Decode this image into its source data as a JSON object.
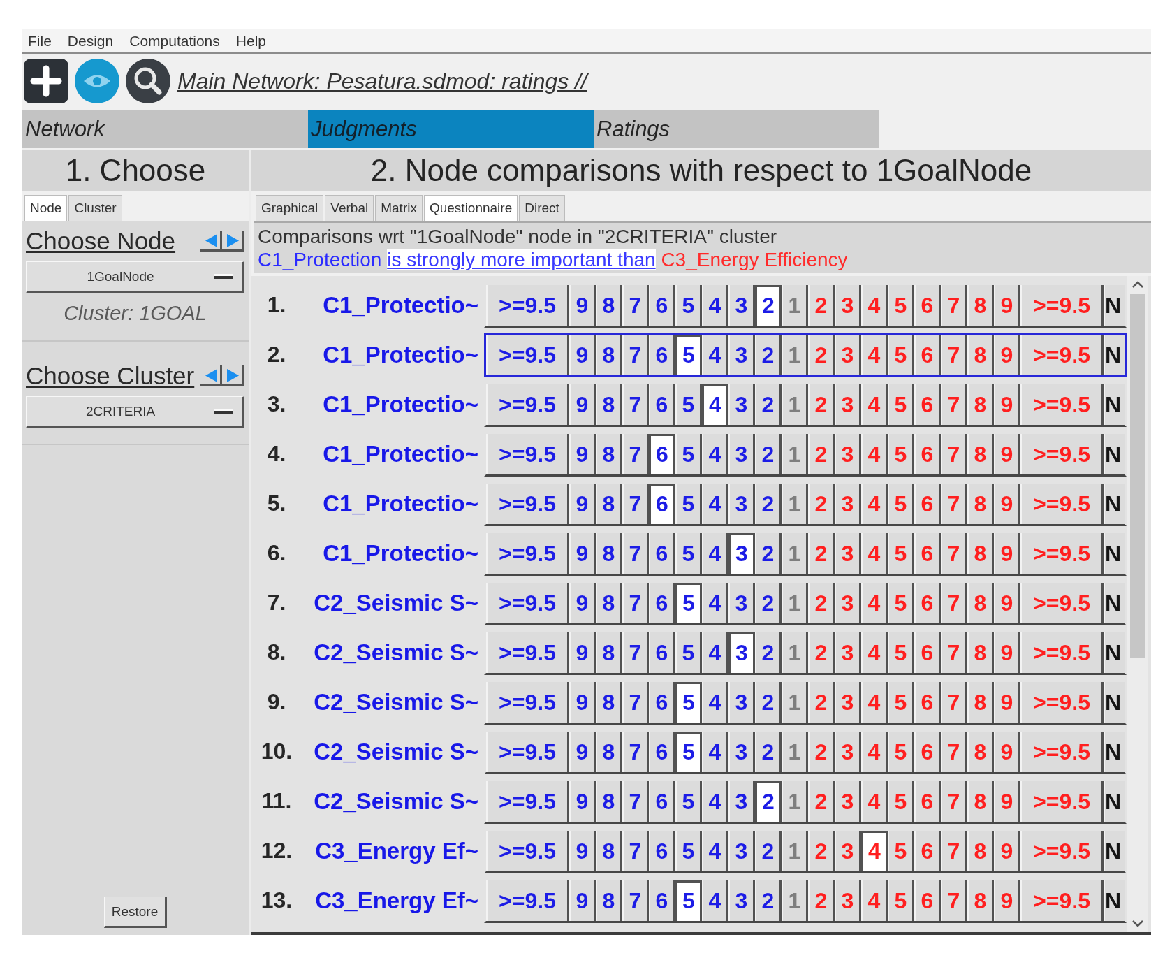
{
  "menu": [
    "File",
    "Design",
    "Computations",
    "Help"
  ],
  "toolbar": {
    "path": "Main Network: Pesatura.sdmod: ratings //"
  },
  "main_tabs": [
    {
      "label": "Network",
      "selected": false
    },
    {
      "label": "Judgments",
      "selected": true
    },
    {
      "label": "Ratings",
      "selected": false
    }
  ],
  "choose_panel": {
    "heading": "1. Choose",
    "tabs": [
      {
        "label": "Node",
        "selected": true
      },
      {
        "label": "Cluster",
        "selected": false
      }
    ],
    "node_label": "Choose Node",
    "node_value": "1GoalNode",
    "cluster_info": "Cluster: 1GOAL",
    "cluster_label": "Choose Cluster",
    "cluster_value": "2CRITERIA",
    "restore": "Restore"
  },
  "comparison_panel": {
    "heading": "2. Node comparisons with respect to 1GoalNode",
    "tabs": [
      {
        "label": "Graphical",
        "selected": false
      },
      {
        "label": "Verbal",
        "selected": false
      },
      {
        "label": "Matrix",
        "selected": false
      },
      {
        "label": "Questionnaire",
        "selected": true
      },
      {
        "label": "Direct",
        "selected": false
      }
    ],
    "description": "Comparisons wrt \"1GoalNode\" node in \"2CRITERIA\" cluster",
    "verdict": {
      "subject": "C1_Protection",
      "relation": "is strongly more important than",
      "object": "C3_Energy Efficiency"
    },
    "rows": [
      {
        "number": "1.",
        "name": "C1_Protectio~",
        "focused": false,
        "left": [
          {
            "label": ">=9.5",
            "selected": false
          },
          {
            "label": "9",
            "selected": false
          },
          {
            "label": "8",
            "selected": false
          },
          {
            "label": "7",
            "selected": false
          },
          {
            "label": "6",
            "selected": false
          },
          {
            "label": "5",
            "selected": false
          },
          {
            "label": "4",
            "selected": false
          },
          {
            "label": "3",
            "selected": false
          },
          {
            "label": "2",
            "selected": true
          }
        ],
        "equal": {
          "label": "1",
          "selected": false
        },
        "right": [
          {
            "label": "2",
            "selected": false
          },
          {
            "label": "3",
            "selected": false
          },
          {
            "label": "4",
            "selected": false
          },
          {
            "label": "5",
            "selected": false
          },
          {
            "label": "6",
            "selected": false
          },
          {
            "label": "7",
            "selected": false
          },
          {
            "label": "8",
            "selected": false
          },
          {
            "label": "9",
            "selected": false
          },
          {
            "label": ">=9.5",
            "selected": false
          }
        ],
        "extra": {
          "label": "N",
          "selected": false
        }
      },
      {
        "number": "2.",
        "name": "C1_Protectio~",
        "focused": true,
        "left": [
          {
            "label": ">=9.5",
            "selected": false
          },
          {
            "label": "9",
            "selected": false
          },
          {
            "label": "8",
            "selected": false
          },
          {
            "label": "7",
            "selected": false
          },
          {
            "label": "6",
            "selected": false
          },
          {
            "label": "5",
            "selected": true
          },
          {
            "label": "4",
            "selected": false
          },
          {
            "label": "3",
            "selected": false
          },
          {
            "label": "2",
            "selected": false
          }
        ],
        "equal": {
          "label": "1",
          "selected": false
        },
        "right": [
          {
            "label": "2",
            "selected": false
          },
          {
            "label": "3",
            "selected": false
          },
          {
            "label": "4",
            "selected": false
          },
          {
            "label": "5",
            "selected": false
          },
          {
            "label": "6",
            "selected": false
          },
          {
            "label": "7",
            "selected": false
          },
          {
            "label": "8",
            "selected": false
          },
          {
            "label": "9",
            "selected": false
          },
          {
            "label": ">=9.5",
            "selected": false
          }
        ],
        "extra": {
          "label": "N",
          "selected": false
        }
      },
      {
        "number": "3.",
        "name": "C1_Protectio~",
        "focused": false,
        "left": [
          {
            "label": ">=9.5",
            "selected": false
          },
          {
            "label": "9",
            "selected": false
          },
          {
            "label": "8",
            "selected": false
          },
          {
            "label": "7",
            "selected": false
          },
          {
            "label": "6",
            "selected": false
          },
          {
            "label": "5",
            "selected": false
          },
          {
            "label": "4",
            "selected": true
          },
          {
            "label": "3",
            "selected": false
          },
          {
            "label": "2",
            "selected": false
          }
        ],
        "equal": {
          "label": "1",
          "selected": false
        },
        "right": [
          {
            "label": "2",
            "selected": false
          },
          {
            "label": "3",
            "selected": false
          },
          {
            "label": "4",
            "selected": false
          },
          {
            "label": "5",
            "selected": false
          },
          {
            "label": "6",
            "selected": false
          },
          {
            "label": "7",
            "selected": false
          },
          {
            "label": "8",
            "selected": false
          },
          {
            "label": "9",
            "selected": false
          },
          {
            "label": ">=9.5",
            "selected": false
          }
        ],
        "extra": {
          "label": "N",
          "selected": false
        }
      },
      {
        "number": "4.",
        "name": "C1_Protectio~",
        "focused": false,
        "left": [
          {
            "label": ">=9.5",
            "selected": false
          },
          {
            "label": "9",
            "selected": false
          },
          {
            "label": "8",
            "selected": false
          },
          {
            "label": "7",
            "selected": false
          },
          {
            "label": "6",
            "selected": true
          },
          {
            "label": "5",
            "selected": false
          },
          {
            "label": "4",
            "selected": false
          },
          {
            "label": "3",
            "selected": false
          },
          {
            "label": "2",
            "selected": false
          }
        ],
        "equal": {
          "label": "1",
          "selected": false
        },
        "right": [
          {
            "label": "2",
            "selected": false
          },
          {
            "label": "3",
            "selected": false
          },
          {
            "label": "4",
            "selected": false
          },
          {
            "label": "5",
            "selected": false
          },
          {
            "label": "6",
            "selected": false
          },
          {
            "label": "7",
            "selected": false
          },
          {
            "label": "8",
            "selected": false
          },
          {
            "label": "9",
            "selected": false
          },
          {
            "label": ">=9.5",
            "selected": false
          }
        ],
        "extra": {
          "label": "N",
          "selected": false
        }
      },
      {
        "number": "5.",
        "name": "C1_Protectio~",
        "focused": false,
        "left": [
          {
            "label": ">=9.5",
            "selected": false
          },
          {
            "label": "9",
            "selected": false
          },
          {
            "label": "8",
            "selected": false
          },
          {
            "label": "7",
            "selected": false
          },
          {
            "label": "6",
            "selected": true
          },
          {
            "label": "5",
            "selected": false
          },
          {
            "label": "4",
            "selected": false
          },
          {
            "label": "3",
            "selected": false
          },
          {
            "label": "2",
            "selected": false
          }
        ],
        "equal": {
          "label": "1",
          "selected": false
        },
        "right": [
          {
            "label": "2",
            "selected": false
          },
          {
            "label": "3",
            "selected": false
          },
          {
            "label": "4",
            "selected": false
          },
          {
            "label": "5",
            "selected": false
          },
          {
            "label": "6",
            "selected": false
          },
          {
            "label": "7",
            "selected": false
          },
          {
            "label": "8",
            "selected": false
          },
          {
            "label": "9",
            "selected": false
          },
          {
            "label": ">=9.5",
            "selected": false
          }
        ],
        "extra": {
          "label": "N",
          "selected": false
        }
      },
      {
        "number": "6.",
        "name": "C1_Protectio~",
        "focused": false,
        "left": [
          {
            "label": ">=9.5",
            "selected": false
          },
          {
            "label": "9",
            "selected": false
          },
          {
            "label": "8",
            "selected": false
          },
          {
            "label": "7",
            "selected": false
          },
          {
            "label": "6",
            "selected": false
          },
          {
            "label": "5",
            "selected": false
          },
          {
            "label": "4",
            "selected": false
          },
          {
            "label": "3",
            "selected": true
          },
          {
            "label": "2",
            "selected": false
          }
        ],
        "equal": {
          "label": "1",
          "selected": false
        },
        "right": [
          {
            "label": "2",
            "selected": false
          },
          {
            "label": "3",
            "selected": false
          },
          {
            "label": "4",
            "selected": false
          },
          {
            "label": "5",
            "selected": false
          },
          {
            "label": "6",
            "selected": false
          },
          {
            "label": "7",
            "selected": false
          },
          {
            "label": "8",
            "selected": false
          },
          {
            "label": "9",
            "selected": false
          },
          {
            "label": ">=9.5",
            "selected": false
          }
        ],
        "extra": {
          "label": "N",
          "selected": false
        }
      },
      {
        "number": "7.",
        "name": "C2_Seismic S~",
        "focused": false,
        "left": [
          {
            "label": ">=9.5",
            "selected": false
          },
          {
            "label": "9",
            "selected": false
          },
          {
            "label": "8",
            "selected": false
          },
          {
            "label": "7",
            "selected": false
          },
          {
            "label": "6",
            "selected": false
          },
          {
            "label": "5",
            "selected": true
          },
          {
            "label": "4",
            "selected": false
          },
          {
            "label": "3",
            "selected": false
          },
          {
            "label": "2",
            "selected": false
          }
        ],
        "equal": {
          "label": "1",
          "selected": false
        },
        "right": [
          {
            "label": "2",
            "selected": false
          },
          {
            "label": "3",
            "selected": false
          },
          {
            "label": "4",
            "selected": false
          },
          {
            "label": "5",
            "selected": false
          },
          {
            "label": "6",
            "selected": false
          },
          {
            "label": "7",
            "selected": false
          },
          {
            "label": "8",
            "selected": false
          },
          {
            "label": "9",
            "selected": false
          },
          {
            "label": ">=9.5",
            "selected": false
          }
        ],
        "extra": {
          "label": "N",
          "selected": false
        }
      },
      {
        "number": "8.",
        "name": "C2_Seismic S~",
        "focused": false,
        "left": [
          {
            "label": ">=9.5",
            "selected": false
          },
          {
            "label": "9",
            "selected": false
          },
          {
            "label": "8",
            "selected": false
          },
          {
            "label": "7",
            "selected": false
          },
          {
            "label": "6",
            "selected": false
          },
          {
            "label": "5",
            "selected": false
          },
          {
            "label": "4",
            "selected": false
          },
          {
            "label": "3",
            "selected": true
          },
          {
            "label": "2",
            "selected": false
          }
        ],
        "equal": {
          "label": "1",
          "selected": false
        },
        "right": [
          {
            "label": "2",
            "selected": false
          },
          {
            "label": "3",
            "selected": false
          },
          {
            "label": "4",
            "selected": false
          },
          {
            "label": "5",
            "selected": false
          },
          {
            "label": "6",
            "selected": false
          },
          {
            "label": "7",
            "selected": false
          },
          {
            "label": "8",
            "selected": false
          },
          {
            "label": "9",
            "selected": false
          },
          {
            "label": ">=9.5",
            "selected": false
          }
        ],
        "extra": {
          "label": "N",
          "selected": false
        }
      },
      {
        "number": "9.",
        "name": "C2_Seismic S~",
        "focused": false,
        "left": [
          {
            "label": ">=9.5",
            "selected": false
          },
          {
            "label": "9",
            "selected": false
          },
          {
            "label": "8",
            "selected": false
          },
          {
            "label": "7",
            "selected": false
          },
          {
            "label": "6",
            "selected": false
          },
          {
            "label": "5",
            "selected": true
          },
          {
            "label": "4",
            "selected": false
          },
          {
            "label": "3",
            "selected": false
          },
          {
            "label": "2",
            "selected": false
          }
        ],
        "equal": {
          "label": "1",
          "selected": false
        },
        "right": [
          {
            "label": "2",
            "selected": false
          },
          {
            "label": "3",
            "selected": false
          },
          {
            "label": "4",
            "selected": false
          },
          {
            "label": "5",
            "selected": false
          },
          {
            "label": "6",
            "selected": false
          },
          {
            "label": "7",
            "selected": false
          },
          {
            "label": "8",
            "selected": false
          },
          {
            "label": "9",
            "selected": false
          },
          {
            "label": ">=9.5",
            "selected": false
          }
        ],
        "extra": {
          "label": "N",
          "selected": false
        }
      },
      {
        "number": "10.",
        "name": "C2_Seismic S~",
        "focused": false,
        "left": [
          {
            "label": ">=9.5",
            "selected": false
          },
          {
            "label": "9",
            "selected": false
          },
          {
            "label": "8",
            "selected": false
          },
          {
            "label": "7",
            "selected": false
          },
          {
            "label": "6",
            "selected": false
          },
          {
            "label": "5",
            "selected": true
          },
          {
            "label": "4",
            "selected": false
          },
          {
            "label": "3",
            "selected": false
          },
          {
            "label": "2",
            "selected": false
          }
        ],
        "equal": {
          "label": "1",
          "selected": false
        },
        "right": [
          {
            "label": "2",
            "selected": false
          },
          {
            "label": "3",
            "selected": false
          },
          {
            "label": "4",
            "selected": false
          },
          {
            "label": "5",
            "selected": false
          },
          {
            "label": "6",
            "selected": false
          },
          {
            "label": "7",
            "selected": false
          },
          {
            "label": "8",
            "selected": false
          },
          {
            "label": "9",
            "selected": false
          },
          {
            "label": ">=9.5",
            "selected": false
          }
        ],
        "extra": {
          "label": "N",
          "selected": false
        }
      },
      {
        "number": "11.",
        "name": "C2_Seismic S~",
        "focused": false,
        "left": [
          {
            "label": ">=9.5",
            "selected": false
          },
          {
            "label": "9",
            "selected": false
          },
          {
            "label": "8",
            "selected": false
          },
          {
            "label": "7",
            "selected": false
          },
          {
            "label": "6",
            "selected": false
          },
          {
            "label": "5",
            "selected": false
          },
          {
            "label": "4",
            "selected": false
          },
          {
            "label": "3",
            "selected": false
          },
          {
            "label": "2",
            "selected": true
          }
        ],
        "equal": {
          "label": "1",
          "selected": false
        },
        "right": [
          {
            "label": "2",
            "selected": false
          },
          {
            "label": "3",
            "selected": false
          },
          {
            "label": "4",
            "selected": false
          },
          {
            "label": "5",
            "selected": false
          },
          {
            "label": "6",
            "selected": false
          },
          {
            "label": "7",
            "selected": false
          },
          {
            "label": "8",
            "selected": false
          },
          {
            "label": "9",
            "selected": false
          },
          {
            "label": ">=9.5",
            "selected": false
          }
        ],
        "extra": {
          "label": "N",
          "selected": false
        }
      },
      {
        "number": "12.",
        "name": "C3_Energy Ef~",
        "focused": false,
        "left": [
          {
            "label": ">=9.5",
            "selected": false
          },
          {
            "label": "9",
            "selected": false
          },
          {
            "label": "8",
            "selected": false
          },
          {
            "label": "7",
            "selected": false
          },
          {
            "label": "6",
            "selected": false
          },
          {
            "label": "5",
            "selected": false
          },
          {
            "label": "4",
            "selected": false
          },
          {
            "label": "3",
            "selected": false
          },
          {
            "label": "2",
            "selected": false
          }
        ],
        "equal": {
          "label": "1",
          "selected": false
        },
        "right": [
          {
            "label": "2",
            "selected": false
          },
          {
            "label": "3",
            "selected": false
          },
          {
            "label": "4",
            "selected": true
          },
          {
            "label": "5",
            "selected": false
          },
          {
            "label": "6",
            "selected": false
          },
          {
            "label": "7",
            "selected": false
          },
          {
            "label": "8",
            "selected": false
          },
          {
            "label": "9",
            "selected": false
          },
          {
            "label": ">=9.5",
            "selected": false
          }
        ],
        "extra": {
          "label": "N",
          "selected": false
        }
      },
      {
        "number": "13.",
        "name": "C3_Energy Ef~",
        "focused": false,
        "left": [
          {
            "label": ">=9.5",
            "selected": false
          },
          {
            "label": "9",
            "selected": false
          },
          {
            "label": "8",
            "selected": false
          },
          {
            "label": "7",
            "selected": false
          },
          {
            "label": "6",
            "selected": false
          },
          {
            "label": "5",
            "selected": true
          },
          {
            "label": "4",
            "selected": false
          },
          {
            "label": "3",
            "selected": false
          },
          {
            "label": "2",
            "selected": false
          }
        ],
        "equal": {
          "label": "1",
          "selected": false
        },
        "right": [
          {
            "label": "2",
            "selected": false
          },
          {
            "label": "3",
            "selected": false
          },
          {
            "label": "4",
            "selected": false
          },
          {
            "label": "5",
            "selected": false
          },
          {
            "label": "6",
            "selected": false
          },
          {
            "label": "7",
            "selected": false
          },
          {
            "label": "8",
            "selected": false
          },
          {
            "label": "9",
            "selected": false
          },
          {
            "label": ">=9.5",
            "selected": false
          }
        ],
        "extra": {
          "label": "N",
          "selected": false
        }
      }
    ]
  }
}
